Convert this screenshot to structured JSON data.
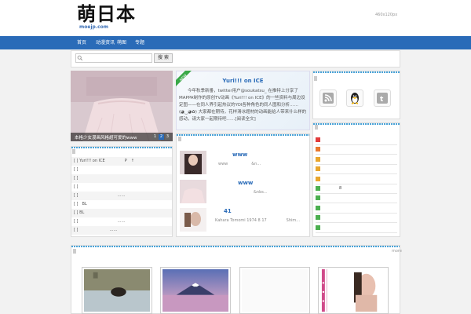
{
  "header": {
    "logo_text": "萌日本",
    "logo_sub": "moejp.com",
    "ad_text": "460x120px"
  },
  "nav": {
    "items": [
      {
        "label": "首页"
      },
      {
        "label": "动漫资讯"
      },
      {
        "label": "萌图"
      },
      {
        "label": "专题"
      }
    ]
  },
  "search": {
    "placeholder": "",
    "button_label": "搜 索"
  },
  "slider": {
    "caption": "本格少女漫画风格超可爱的www",
    "pages": [
      "1",
      "2",
      "3"
    ]
  },
  "featured": {
    "ribbon": "NEW",
    "title": "Yuri!!! on ICE",
    "body": "　　今年秋季新番，twitter用户@soukatsu_ 在推特上分享了MAPPA制作的原创TV动画《Yuri!!! on ICE》的一些资料与周边设定图——在同人界引起热议的YOI各种角色的同人图和分析……(◕‿◕✿) 大家都在期待，花样滑冰题材的动画能给人带来什么样的感动，请大家一起期待吧……[阅读全文]"
  },
  "categories": {
    "rows": [
      {
        "text": "[ ] Yuri!!! on ICE　　　　　P　↑"
      },
      {
        "text": "[ ]"
      },
      {
        "text": "[ ]"
      },
      {
        "text": "[ ]"
      },
      {
        "text": "[ ]　　　　　　　　　　……"
      },
      {
        "text": "[ ]　BL"
      },
      {
        "text": "[ ] BL"
      },
      {
        "text": "[ ]　　　　　　　　　　……"
      },
      {
        "text": "[ ]　　　　　　　　……"
      }
    ]
  },
  "posts": [
    {
      "title": "www",
      "meta": "www　　　　　　&n..."
    },
    {
      "title": "www",
      "meta": "　　　　　　　　　&nbs..."
    },
    {
      "title": "41",
      "meta": "Kahara Tomomi 1974 8 17　　　　　Shim..."
    }
  ],
  "ranking": {
    "rows": [
      {
        "text": ""
      },
      {
        "text": ""
      },
      {
        "text": ""
      },
      {
        "text": ""
      },
      {
        "text": ""
      },
      {
        "text": "　　　　8"
      },
      {
        "text": ""
      },
      {
        "text": ""
      },
      {
        "text": ""
      },
      {
        "text": ""
      }
    ]
  },
  "gallery": {
    "more": "more"
  },
  "colors": {
    "brand": "#2a6bb8",
    "accent_line": "#4aa3d8",
    "rank_colors": [
      "#e23b3b",
      "#e8772d",
      "#e8a52d",
      "#e8a52d",
      "#e8a52d",
      "#4caf50",
      "#4caf50",
      "#4caf50",
      "#4caf50",
      "#4caf50"
    ]
  }
}
